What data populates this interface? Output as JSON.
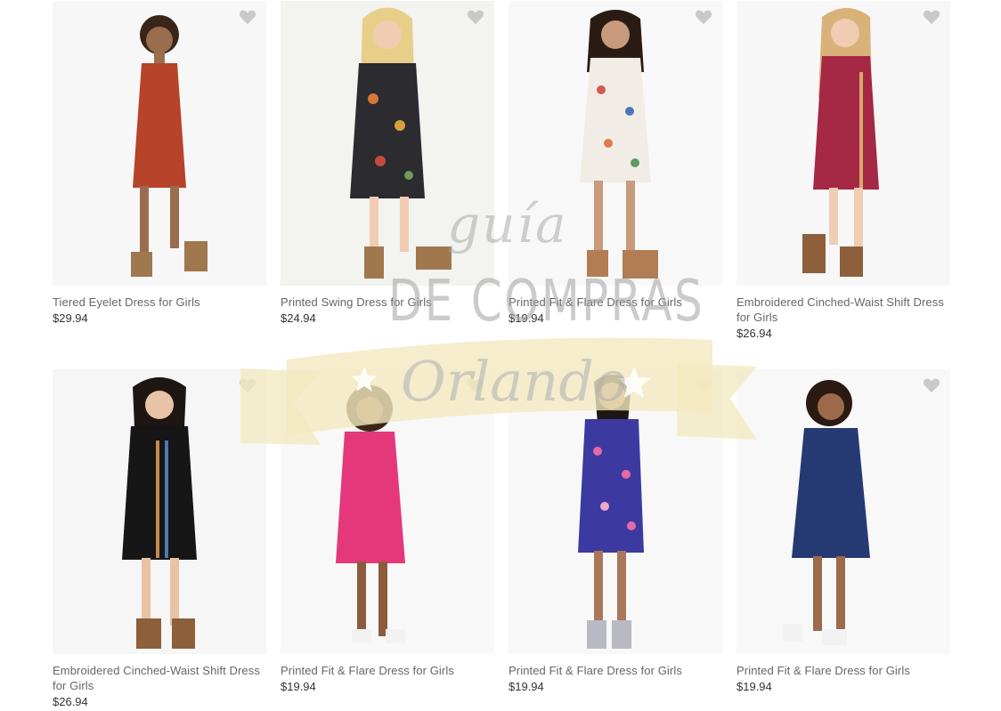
{
  "products": [
    {
      "name": "Tiered Eyelet Dress for Girls",
      "price": "$29.94",
      "dress": "#b7432b"
    },
    {
      "name": "Printed Swing Dress for Girls",
      "price": "$24.94",
      "dress": "#2b2b30"
    },
    {
      "name": "Printed Fit & Flare Dress for Girls",
      "price": "$19.94",
      "dress": "#f1ece6"
    },
    {
      "name": "Embroidered Cinched-Waist Shift Dress for Girls",
      "price": "$26.94",
      "dress": "#a52844"
    },
    {
      "name": "Embroidered Cinched-Waist Shift Dress for Girls",
      "price": "$26.94",
      "dress": "#161616"
    },
    {
      "name": "Printed Fit & Flare Dress for Girls",
      "price": "$19.94",
      "dress": "#e5387a"
    },
    {
      "name": "Printed Fit & Flare Dress for Girls",
      "price": "$19.94",
      "dress": "#3c3aa0"
    },
    {
      "name": "Printed Fit & Flare Dress for Girls",
      "price": "$19.94",
      "dress": "#253a72"
    }
  ],
  "icons": {
    "favorite": "heart-icon"
  },
  "watermark": {
    "line1": "guía",
    "line2": "DE COMPRAS",
    "line3": "Orlando"
  },
  "colors": {
    "heart": "#c9c9c9",
    "ribbon": "#f3e9bf",
    "text": "#666666",
    "price": "#333333"
  }
}
